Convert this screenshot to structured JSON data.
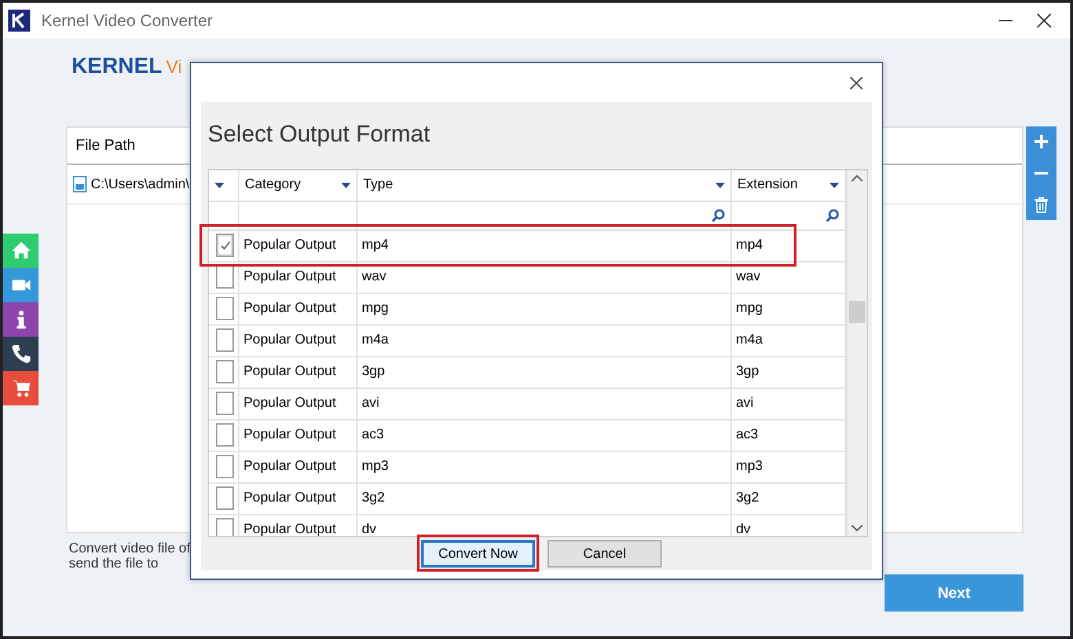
{
  "window": {
    "title": "Kernel Video Converter"
  },
  "logo": {
    "brand": "KERNEL",
    "product": "Vi"
  },
  "file_list": {
    "columns": [
      "File Path"
    ],
    "rows": [
      {
        "path": "C:\\Users\\admin\\"
      }
    ]
  },
  "footer_note": [
    "Convert video file of",
    "send the file to"
  ],
  "next_button": "Next",
  "dialog": {
    "title": "Select Output Format",
    "columns": [
      "Category",
      "Type",
      "Extension"
    ],
    "rows": [
      {
        "checked": true,
        "highlighted": true,
        "category": "Popular Output",
        "type": "mp4",
        "extension": "mp4"
      },
      {
        "checked": false,
        "highlighted": false,
        "category": "Popular Output",
        "type": "wav",
        "extension": "wav"
      },
      {
        "checked": false,
        "highlighted": false,
        "category": "Popular Output",
        "type": "mpg",
        "extension": "mpg"
      },
      {
        "checked": false,
        "highlighted": false,
        "category": "Popular Output",
        "type": "m4a",
        "extension": "m4a"
      },
      {
        "checked": false,
        "highlighted": false,
        "category": "Popular Output",
        "type": "3gp",
        "extension": "3gp"
      },
      {
        "checked": false,
        "highlighted": false,
        "category": "Popular Output",
        "type": "avi",
        "extension": "avi"
      },
      {
        "checked": false,
        "highlighted": false,
        "category": "Popular Output",
        "type": "ac3",
        "extension": "ac3"
      },
      {
        "checked": false,
        "highlighted": false,
        "category": "Popular Output",
        "type": "mp3",
        "extension": "mp3"
      },
      {
        "checked": false,
        "highlighted": false,
        "category": "Popular Output",
        "type": "3g2",
        "extension": "3g2"
      },
      {
        "checked": false,
        "highlighted": false,
        "category": "Popular Output",
        "type": "dv",
        "extension": "dv"
      }
    ],
    "buttons": [
      {
        "label": "Convert Now",
        "highlighted": true
      },
      {
        "label": "Cancel",
        "highlighted": false
      }
    ]
  }
}
